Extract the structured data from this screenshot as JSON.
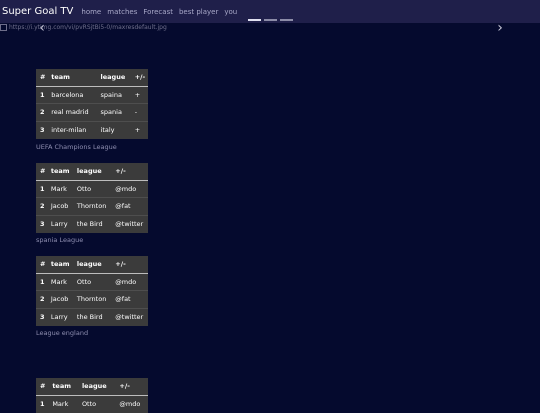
{
  "navbar": {
    "brand": "Super Goal TV",
    "links": [
      "home",
      "matches",
      "Forecast",
      "best player",
      "you"
    ]
  },
  "carousel": {
    "image_alt": "https://i2-prod.mirror.co.uk/incoming/article15164117.ece/ALTERNATES/s1200/0_Liverpool-v-Tottenham-Hotspur-UEFA-Champions-League-Final.jpg",
    "image_alt_visible": "https://i.ytimg.com/vi/pvRSjtBi5-0/maxresdefault.jpg",
    "prev": "‹",
    "next": "›"
  },
  "table1": {
    "headers": [
      "#",
      "team",
      "league",
      "+/-"
    ],
    "rows": [
      [
        "1",
        "barcelona",
        "spaina",
        "+"
      ],
      [
        "2",
        "real madrid",
        "spania",
        "-"
      ],
      [
        "3",
        "inter-milan",
        "italy",
        "+"
      ]
    ],
    "caption": "UEFA Champions League"
  },
  "table2": {
    "headers": [
      "#",
      "team",
      "league",
      "+/-"
    ],
    "rows": [
      [
        "1",
        "Mark",
        "Otto",
        "@mdo"
      ],
      [
        "2",
        "Jacob",
        "Thornton",
        "@fat"
      ],
      [
        "3",
        "Larry",
        "the Bird",
        "@twitter"
      ]
    ],
    "caption": "spania League"
  },
  "table3": {
    "headers": [
      "#",
      "team",
      "league",
      "+/-"
    ],
    "rows": [
      [
        "1",
        "Mark",
        "Otto",
        "@mdo"
      ],
      [
        "2",
        "Jacob",
        "Thornton",
        "@fat"
      ],
      [
        "3",
        "Larry",
        "the Bird",
        "@twitter"
      ]
    ],
    "caption": "League england"
  },
  "table4": {
    "headers": [
      "#",
      "team",
      "league",
      "+/-"
    ],
    "rows": [
      [
        "1",
        "Mark",
        "Otto",
        "@mdo"
      ]
    ]
  }
}
